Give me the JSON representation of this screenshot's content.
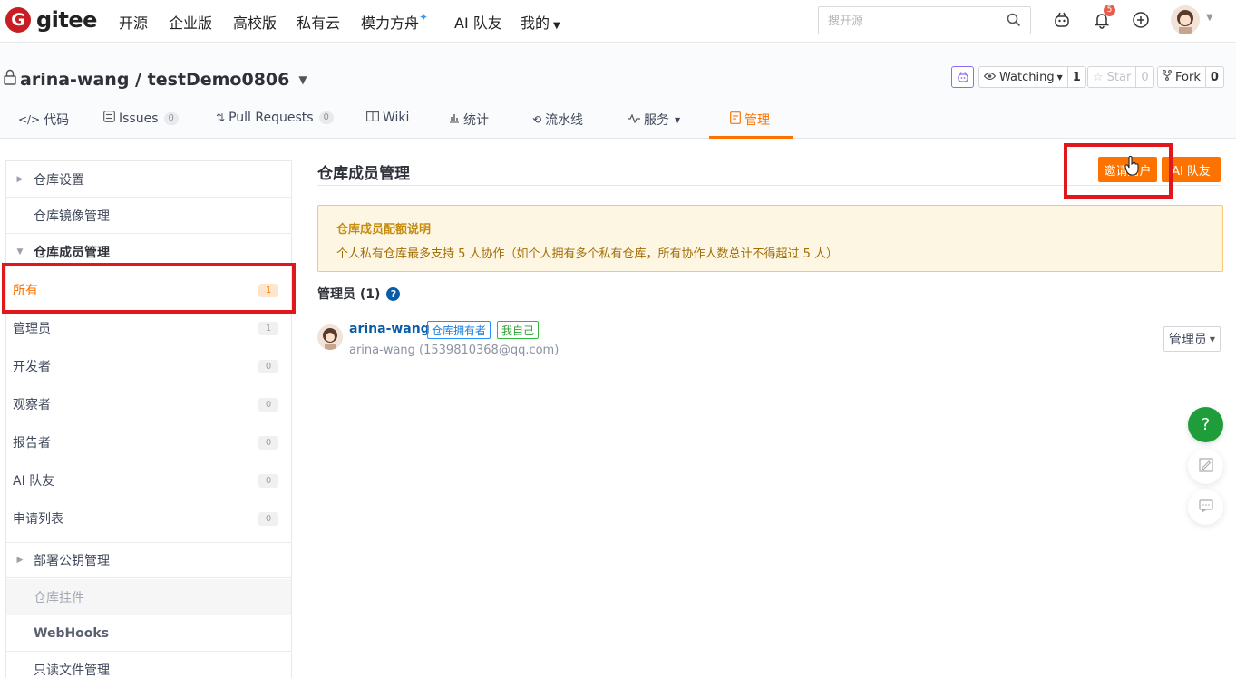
{
  "nav": {
    "logo_letter": "G",
    "brand": "gitee",
    "items": [
      "开源",
      "企业版",
      "高校版",
      "私有云",
      "模力方舟",
      "AI 队友",
      "我的"
    ],
    "search_placeholder": "搜开源",
    "notification_count": "5"
  },
  "repo": {
    "title": "arina-wang / testDemo0806",
    "watching_label": "Watching",
    "watching_count": "1",
    "star_label": "Star",
    "star_count": "0",
    "fork_label": "Fork",
    "fork_count": "0",
    "tabs": {
      "code": "代码",
      "issues": "Issues",
      "issues_count": "0",
      "prs": "Pull Requests",
      "prs_count": "0",
      "wiki": "Wiki",
      "stats": "统计",
      "pipeline": "流水线",
      "service": "服务",
      "manage": "管理"
    }
  },
  "sidebar": {
    "repo_settings": "仓库设置",
    "mirror": "仓库镜像管理",
    "members": "仓库成员管理",
    "items": [
      {
        "label": "所有",
        "count": "1"
      },
      {
        "label": "管理员",
        "count": "1"
      },
      {
        "label": "开发者",
        "count": "0"
      },
      {
        "label": "观察者",
        "count": "0"
      },
      {
        "label": "报告者",
        "count": "0"
      },
      {
        "label": "AI 队友",
        "count": "0"
      },
      {
        "label": "申请列表",
        "count": "0"
      }
    ],
    "deploy_keys": "部署公钥管理",
    "widgets": "仓库挂件",
    "webhooks": "WebHooks",
    "readonly": "只读文件管理"
  },
  "main": {
    "title": "仓库成员管理",
    "invite_button": "邀请用户",
    "ai_button": "AI 队友",
    "notice_title": "仓库成员配额说明",
    "notice_body": "个人私有仓库最多支持 5 人协作（如个人拥有多个私有仓库，所有协作人数总计不得超过 5 人）",
    "admin_heading": "管理员 (1)",
    "member": {
      "name": "arina-wang",
      "tag_owner": "仓库拥有者",
      "tag_self": "我自己",
      "sub": "arina-wang (1539810368@qq.com)",
      "role": "管理员"
    }
  },
  "colors": {
    "accent": "#fe7300",
    "brand": "#c71d23",
    "highlight_box": "#e0181d",
    "link": "#0a5ca8"
  },
  "icons": [
    "search-icon",
    "copilot-icon",
    "bell-icon",
    "plus-circle-icon",
    "lock-icon",
    "eye-icon",
    "star-icon",
    "fork-icon",
    "help-icon",
    "feedback-icon",
    "chat-icon",
    "cursor-hand-icon"
  ]
}
